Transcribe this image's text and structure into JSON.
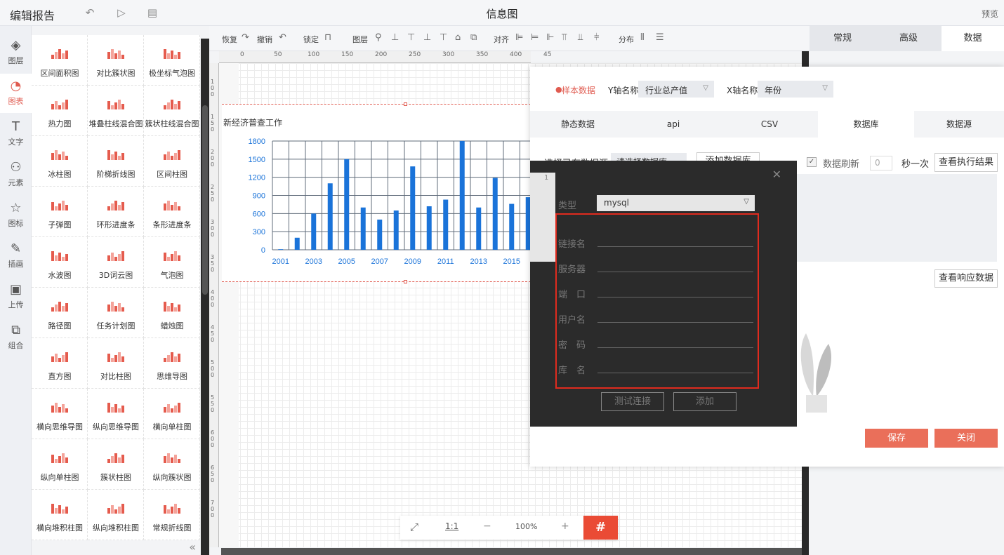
{
  "topbar": {
    "title": "编辑报告",
    "center": "信息图",
    "preview": "预览"
  },
  "nav": [
    {
      "label": "图层",
      "icon": "layers-icon",
      "glyph": "◈"
    },
    {
      "label": "图表",
      "icon": "pie-chart-icon",
      "glyph": "◔"
    },
    {
      "label": "文字",
      "icon": "text-icon",
      "glyph": "T"
    },
    {
      "label": "元素",
      "icon": "elements-icon",
      "glyph": "⚇"
    },
    {
      "label": "图标",
      "icon": "star-icon",
      "glyph": "☆"
    },
    {
      "label": "插画",
      "icon": "palette-icon",
      "glyph": "✎"
    },
    {
      "label": "上传",
      "icon": "upload-icon",
      "glyph": "▣"
    },
    {
      "label": "组合",
      "icon": "group-icon",
      "glyph": "⧉"
    }
  ],
  "palette": [
    "区间面积图",
    "对比簇状图",
    "极坐标气泡图",
    "热力图",
    "堆叠柱线混合图",
    "簇状柱线混合图",
    "冰柱图",
    "阶梯折线图",
    "区间柱图",
    "子弹图",
    "环形进度条",
    "条形进度条",
    "水波图",
    "3D词云图",
    "气泡图",
    "路径图",
    "任务计划图",
    "蜡烛图",
    "直方图",
    "对比柱图",
    "思维导图",
    "横向思维导图",
    "纵向思维导图",
    "横向单柱图",
    "纵向单柱图",
    "簇状柱图",
    "纵向簇状图",
    "横向堆积柱图",
    "纵向堆积柱图",
    "常规折线图"
  ],
  "toolbar": {
    "redo": "恢复",
    "undo": "撤销",
    "lock": "锁定",
    "layer": "图层",
    "align": "对齐",
    "distribute": "分布"
  },
  "ruler_ticks": [
    "0",
    "50",
    "100",
    "150",
    "200",
    "250",
    "300",
    "350",
    "400",
    "45"
  ],
  "vruler_ticks": [
    "100",
    "150",
    "200",
    "250",
    "300",
    "350",
    "400",
    "450",
    "500",
    "550",
    "600",
    "650",
    "700"
  ],
  "chart_data": {
    "type": "bar",
    "title": "新经济普查工作",
    "categories": [
      "2001",
      "2002",
      "2003",
      "2004",
      "2005",
      "2006",
      "2007",
      "2008",
      "2009",
      "2010",
      "2011",
      "2012",
      "2013",
      "2014",
      "2015",
      "2016"
    ],
    "x_tick_labels": [
      "2001",
      "2003",
      "2005",
      "2007",
      "2009",
      "2011",
      "2013",
      "2015"
    ],
    "values": [
      10,
      200,
      600,
      1100,
      1500,
      700,
      500,
      650,
      1380,
      720,
      830,
      1800,
      700,
      1190,
      760,
      870
    ],
    "ylim": [
      0,
      1800
    ],
    "yticks": [
      "1800",
      "1500",
      "1200",
      "900",
      "600",
      "300",
      "0"
    ],
    "color": "#1a73d9",
    "grid": true
  },
  "right_tabs": [
    "常规",
    "高级",
    "数据"
  ],
  "data_panel": {
    "sample": "样本数据",
    "y_axis_label": "Y轴名称",
    "y_axis_value": "行业总产值",
    "x_axis_label": "X轴名称",
    "x_axis_value": "年份",
    "tabs": [
      "静态数据",
      "api",
      "CSV",
      "数据库",
      "数据源"
    ],
    "choose_source": "选择已有数据源",
    "choose_placeholder": "请选择数据库",
    "add_source": "添加数据库",
    "refresh_label": "数据刷新",
    "refresh_value": "0",
    "refresh_unit": "秒一次",
    "view_exec": "查看执行结果",
    "view_response": "查看响应数据",
    "save": "保存",
    "close": "关闭",
    "line_no": "1"
  },
  "db_dialog": {
    "type_label": "类型",
    "type_value": "mysql",
    "fields": [
      "链接名",
      "服务器",
      "端　口",
      "用户名",
      "密　码",
      "库　名"
    ],
    "test": "测试连接",
    "add": "添加",
    "close_glyph": "✕"
  },
  "zoom": {
    "fit": "⤢",
    "one": "1:1",
    "minus": "−",
    "level": "100%",
    "plus": "+",
    "grid": "#"
  }
}
